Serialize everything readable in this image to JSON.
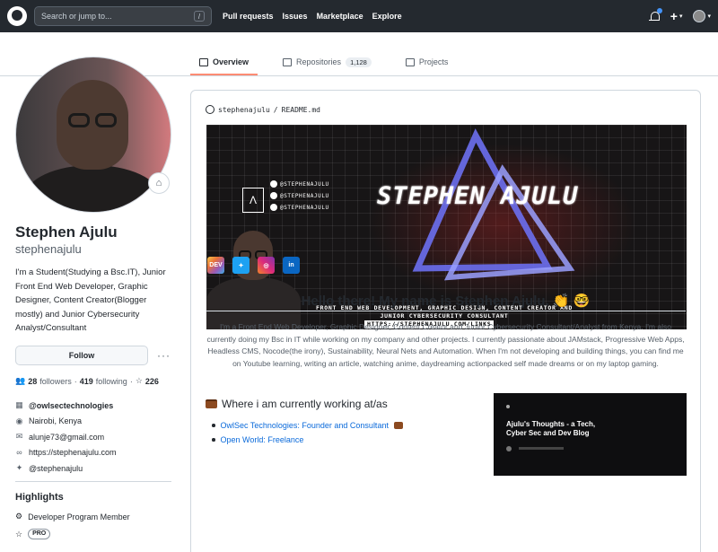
{
  "nav": {
    "search_placeholder": "Search or jump to...",
    "search_shortcut": "/",
    "links": [
      "Pull requests",
      "Issues",
      "Marketplace",
      "Explore"
    ],
    "plus": "+",
    "caret": "▾"
  },
  "tabs": [
    {
      "label": "Overview",
      "active": true
    },
    {
      "label": "Repositories",
      "count": "1,128"
    },
    {
      "label": "Projects"
    }
  ],
  "profile": {
    "name": "Stephen Ajulu",
    "login": "stephenajulu",
    "bio": "I'm a Student(Studying a Bsc.IT), Junior Front End Web Developer, Graphic Designer, Content Creator(Blogger mostly) and Junior Cybersecurity Analyst/Consultant",
    "follow_label": "Follow",
    "more": "···",
    "followers": "28",
    "followers_label": "followers",
    "following": "419",
    "following_label": "following",
    "stars": "226",
    "org": "@owlsectechnologies",
    "location": "Nairobi, Kenya",
    "email": "alunje73@gmail.com",
    "website": "https://stephenajulu.com",
    "twitter": "@stephenajulu"
  },
  "highlights": {
    "title": "Highlights",
    "items": [
      "Developer Program Member",
      "PRO"
    ]
  },
  "readme": {
    "path_user": "stephenajulu",
    "path_sep": "/",
    "path_file": "README.md",
    "banner": {
      "name": "STEPHEN AJULU",
      "socials": [
        "@STEPHENAJULU",
        "@STEPHENAJULU",
        "@STEPHENAJULU"
      ],
      "description": "FRONT END WEB DEVELOPMENT, GRAPHIC DESIGN, CONTENT CREATOR AND JUNIOR CYBERSECURITY CONSULTANT",
      "url": "HTTPS://STEPHENAJULU.COM/LINKS"
    },
    "social_icons": [
      {
        "name": "dev-icon",
        "label": "DEV",
        "color": "#e8a13a"
      },
      {
        "name": "twitter-icon",
        "label": "",
        "color": "#1da1f2"
      },
      {
        "name": "instagram-icon",
        "label": "",
        "color": "#c13584"
      },
      {
        "name": "linkedin-icon",
        "label": "in",
        "color": "#0a66c2"
      }
    ],
    "greeting": "Hello there! My name is Stephen Ajulu. 👏 🤓",
    "paragraph": "I'm a Front End Web Developer, Graphic Designer, Content Creator and Junior Cybersecurity Consultant/Analyst from Kenya. I'm also currently doing my Bsc in IT while working on my company and other projects. I currently passionate about JAMstack, Progressive Web Apps, Headless CMS, Nocode(the irony), Sustainability, Neural Nets and Automation. When I'm not developing and building things, you can find me on Youtube learning, writing an article, watching anime, daydreaming actionpacked self made dreams or on my laptop gaming.",
    "work_heading": "Where i am currently working at/as",
    "work_items": [
      "OwlSec Technologies: Founder and Consultant",
      "Open World: Freelance"
    ],
    "blog_card_title": "Ajulu's Thoughts - a Tech, Cyber Sec and Dev Blog"
  }
}
